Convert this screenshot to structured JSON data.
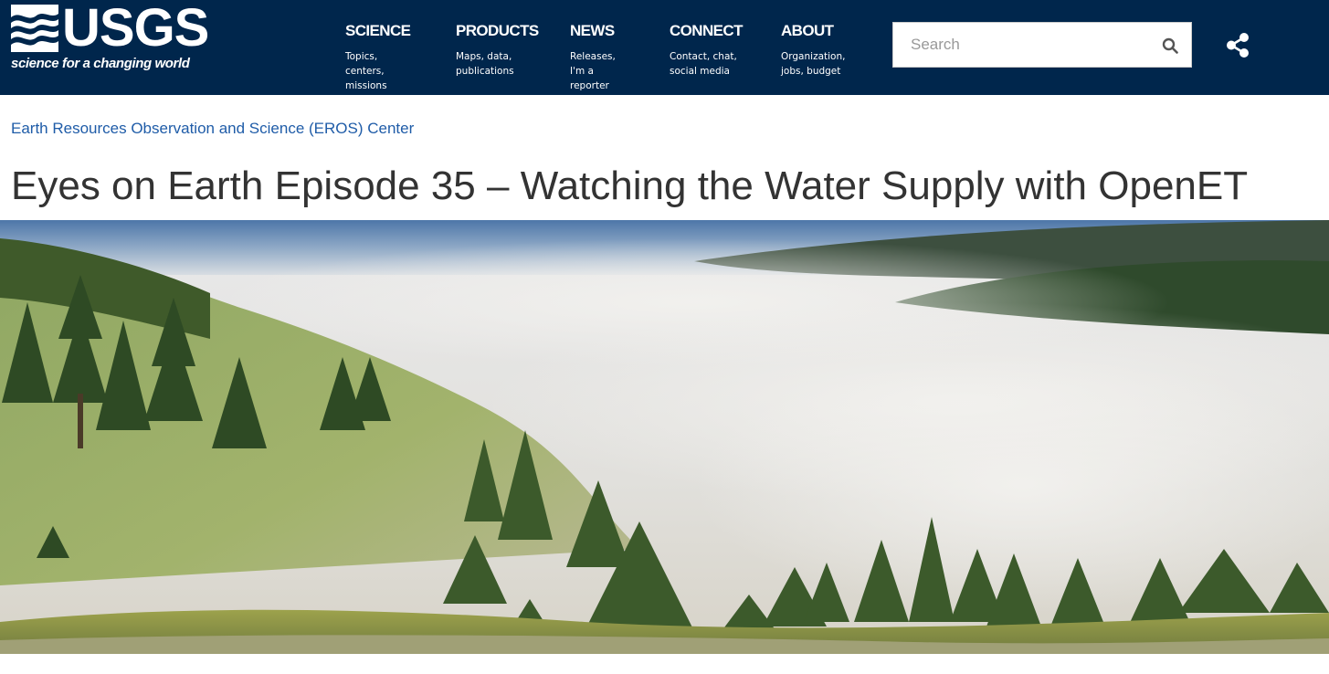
{
  "header": {
    "logo_text": "USGS",
    "logo_tagline": "science for a changing world",
    "bg_color": "#00264c"
  },
  "nav": [
    {
      "title": "SCIENCE",
      "sub": "Topics, centers,\nmissions"
    },
    {
      "title": "PRODUCTS",
      "sub": "Maps, data,\npublications"
    },
    {
      "title": "NEWS",
      "sub": "Releases,\nI'm a reporter"
    },
    {
      "title": "CONNECT",
      "sub": "Contact, chat,\nsocial media"
    },
    {
      "title": "ABOUT",
      "sub": "Organization,\njobs, budget"
    }
  ],
  "search": {
    "placeholder": "Search",
    "value": ""
  },
  "icons": {
    "search": "search-icon",
    "share": "share-icon",
    "logo": "usgs-wave-logo-icon"
  },
  "breadcrumb": "Earth Resources Observation and Science (EROS) Center",
  "page_title": "Eyes on Earth Episode 35 – Watching the Water Supply with OpenET",
  "colors": {
    "link": "#1f5ca8",
    "title": "#333333"
  }
}
